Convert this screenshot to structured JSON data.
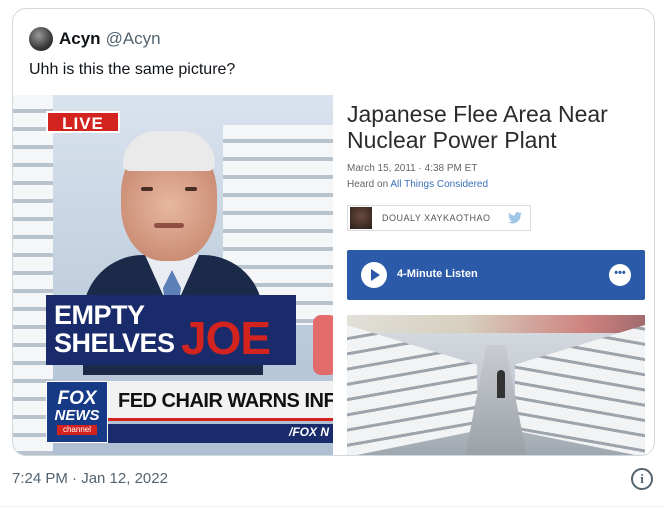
{
  "tweet": {
    "author_name": "Acyn",
    "author_handle": "@Acyn",
    "text": "Uhh is this the same picture?",
    "timestamp": "7:24 PM · Jan 12, 2022"
  },
  "left_image": {
    "live_badge": "LIVE",
    "lower_third_line1": "EMPTY",
    "lower_third_line2": "SHELVES",
    "lower_third_highlight": "JOE",
    "logo_fox": "FOX",
    "logo_news": "NEWS",
    "logo_channel": "channel",
    "ticker_text": "FED CHAIR WARNS INFLA",
    "ticker_small": "/FOX N",
    "colors": {
      "live_red": "#d3231f",
      "fox_blue": "#163a85"
    }
  },
  "right_image": {
    "title": "Japanese Flee Area Near Nuclear Power Plant",
    "date": "March 15, 2011 · 4:38 PM ET",
    "heard_on_prefix": "Heard on",
    "heard_on_program": "All Things Considered",
    "byline_name": "DOUALY XAYKAOTHAO",
    "listen_label": "4-Minute Listen",
    "more_glyph": "•••",
    "colors": {
      "listen_blue": "#2b5aa8"
    }
  },
  "icons": {
    "info": "i",
    "twitter_bird": "twitter-bird-icon"
  }
}
